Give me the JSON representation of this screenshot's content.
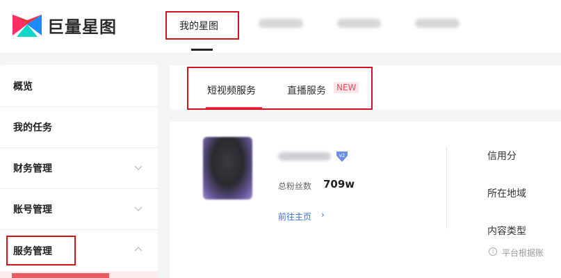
{
  "header": {
    "logo_text": "巨量星图",
    "nav": {
      "active_label": "我的星图"
    }
  },
  "sidebar": {
    "items": [
      {
        "label": "概览",
        "expandable": false
      },
      {
        "label": "我的任务",
        "expandable": false
      },
      {
        "label": "财务管理",
        "expandable": true
      },
      {
        "label": "账号管理",
        "expandable": true
      },
      {
        "label": "服务管理",
        "expandable": true
      }
    ]
  },
  "service_tabs": {
    "short_video": "短视频服务",
    "live": "直播服务",
    "live_badge": "NEW"
  },
  "profile": {
    "verified_badge": "v2",
    "fans_label": "总粉丝数",
    "fans_value": "709w",
    "homepage_link": "前往主页",
    "homepage_arrow": "›"
  },
  "info": {
    "credit_label": "信用分",
    "region_label": "所在地域",
    "content_type_label": "内容类型",
    "note_icon": "i",
    "note_text": "平台根据账"
  },
  "colors": {
    "highlight_box": "#d0141a",
    "accent_red": "#f2304a",
    "link_blue": "#3a6fd8",
    "badge_bg": "#fde7ea"
  },
  "icons": [
    "logo-icon",
    "chevron-down-icon",
    "chevron-up-icon",
    "verified-icon",
    "info-icon",
    "chevron-right-icon"
  ]
}
